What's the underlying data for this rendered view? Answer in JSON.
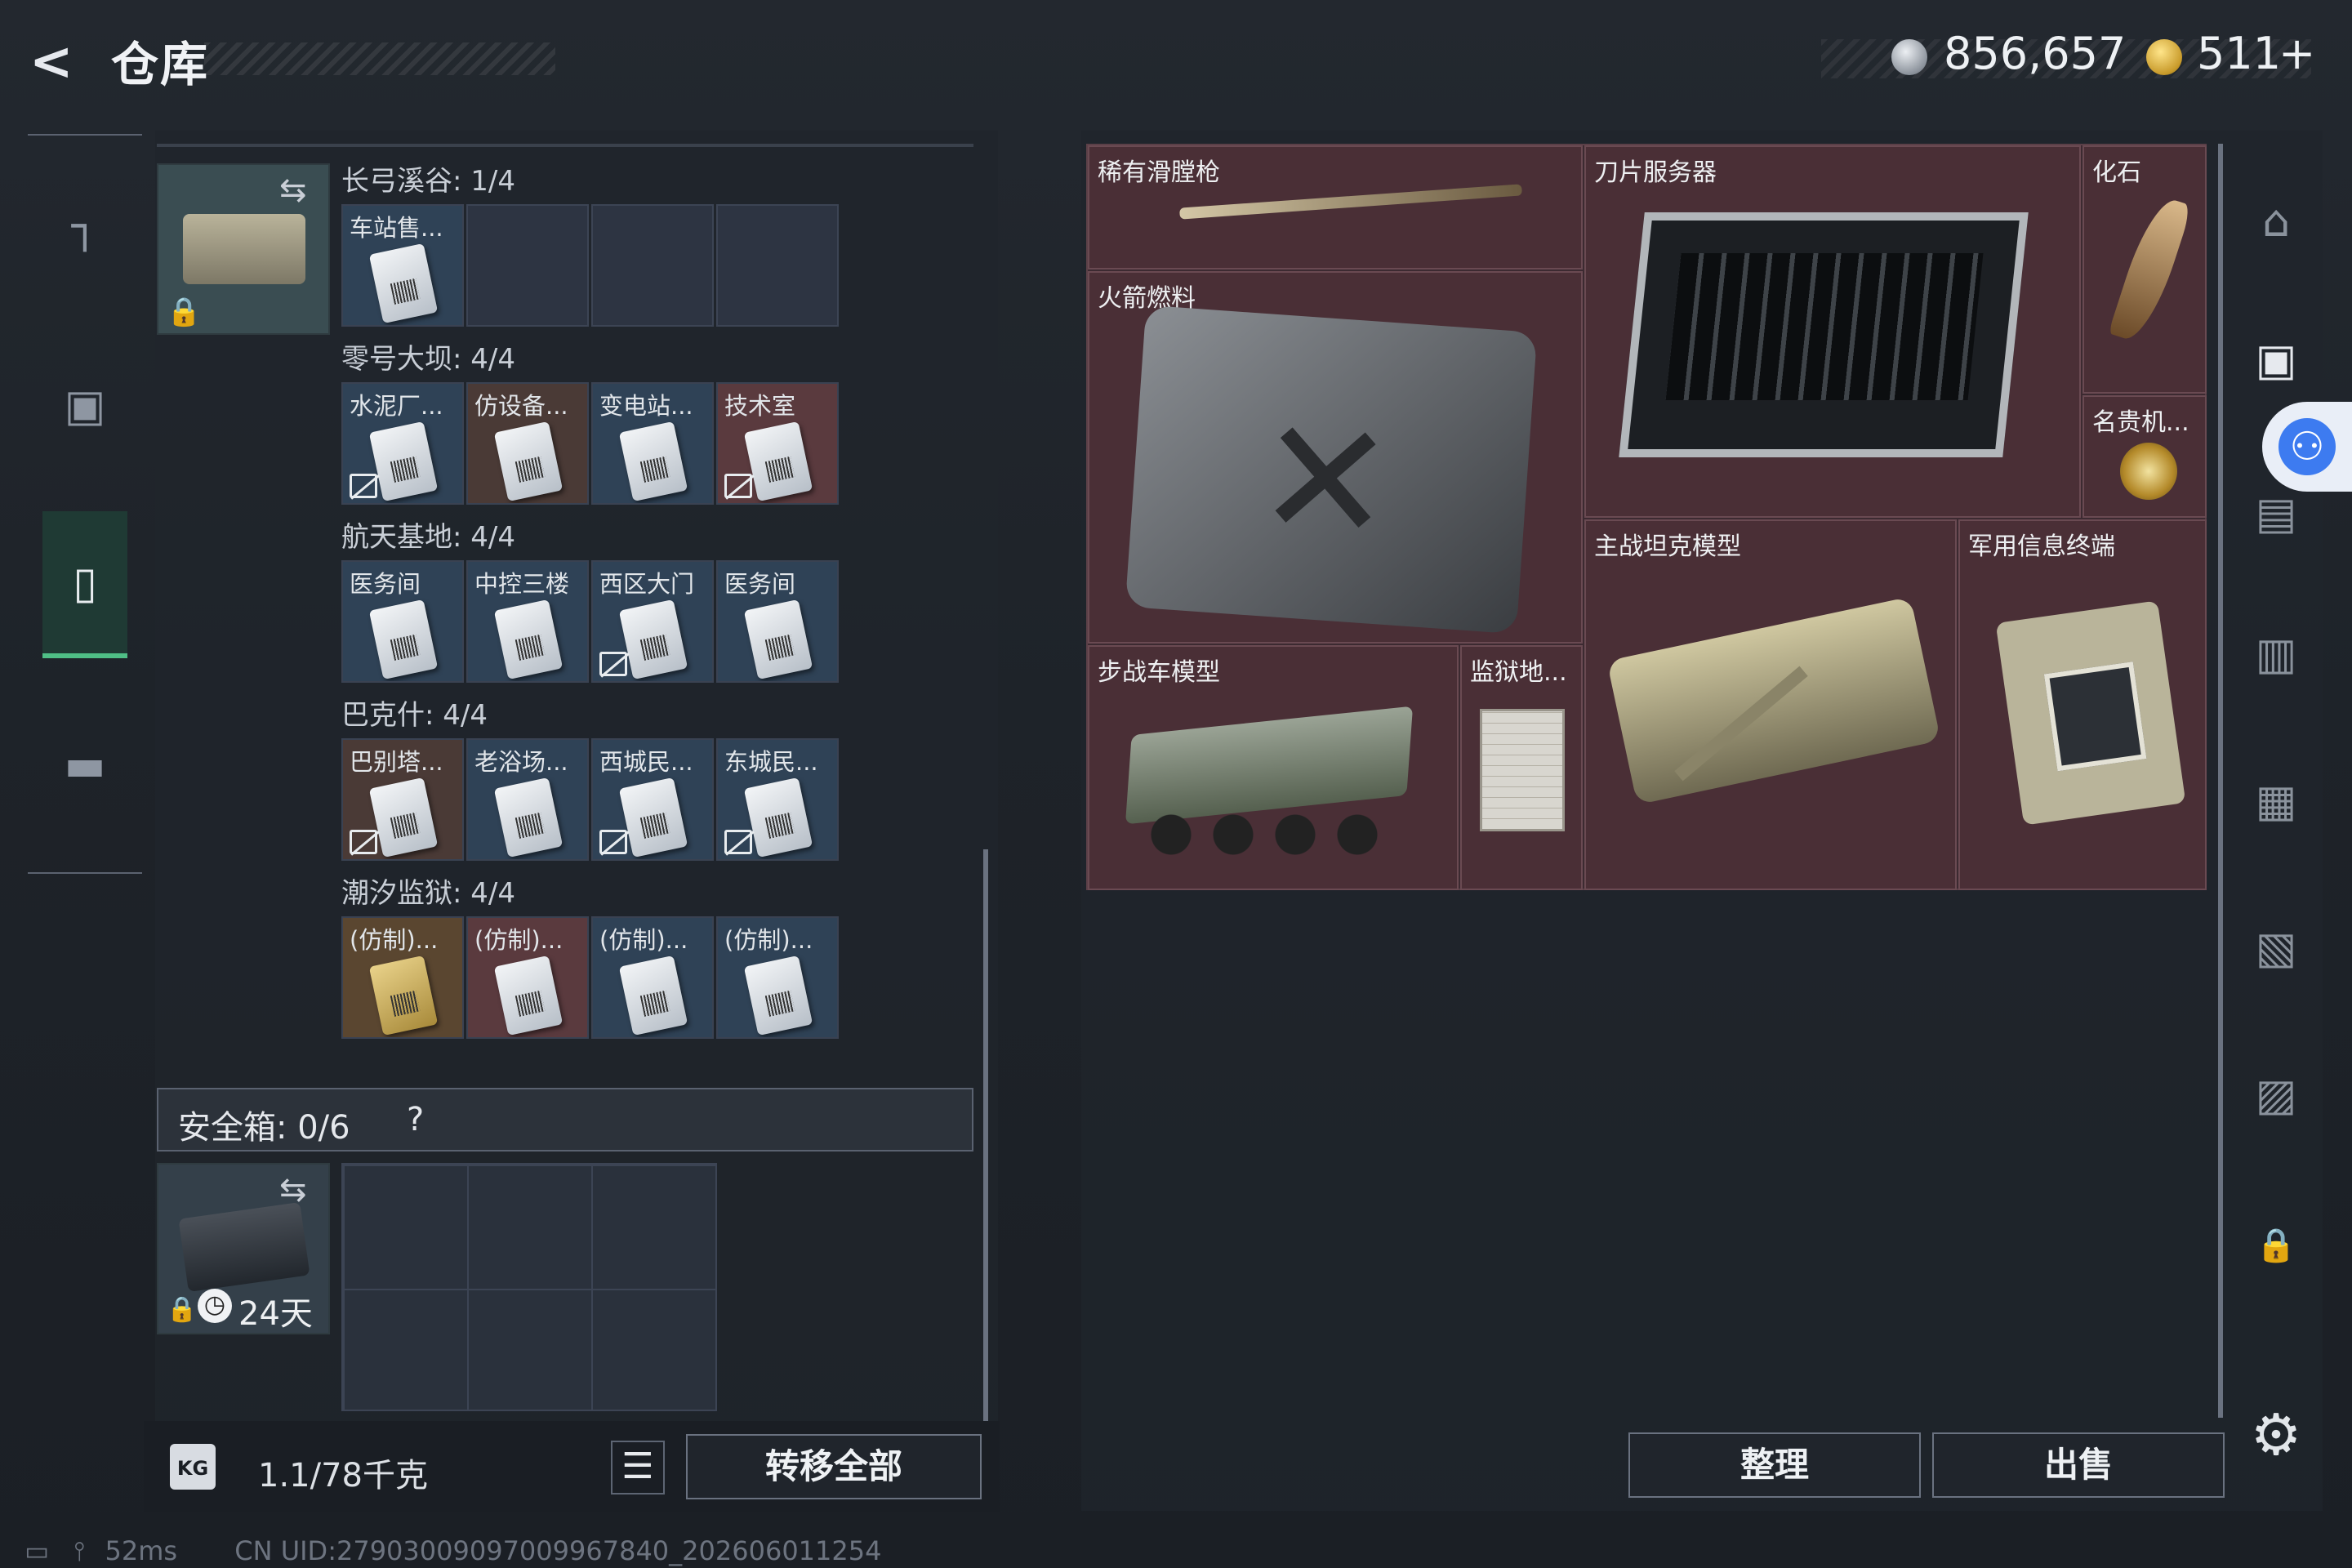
{
  "header": {
    "back_icon": "back-arrow-icon",
    "title": "仓库",
    "currency1": "856,657",
    "currency2": "511",
    "plus": "+"
  },
  "sidebar": {
    "items": [
      {
        "name": "weapons",
        "icon": "gun-icon"
      },
      {
        "name": "gear",
        "icon": "backpack-icon"
      },
      {
        "name": "keys",
        "icon": "clipboard-icon"
      },
      {
        "name": "misc",
        "icon": "briefcase-icon"
      }
    ]
  },
  "keycards": {
    "groups": [
      {
        "title": "长弓溪谷: 1/4",
        "slots": [
          "车站售...",
          "",
          "",
          ""
        ]
      },
      {
        "title": "零号大坝: 4/4",
        "slots": [
          "水泥厂...",
          "仿设备...",
          "变电站...",
          "技术室"
        ]
      },
      {
        "title": "航天基地: 4/4",
        "slots": [
          "医务间",
          "中控三楼",
          "西区大门",
          "医务间"
        ]
      },
      {
        "title": "巴克什: 4/4",
        "slots": [
          "巴别塔...",
          "老浴场...",
          "西城民...",
          "东城民..."
        ]
      },
      {
        "title": "潮汐监狱: 4/4",
        "slots": [
          "(仿制)...",
          "(仿制)...",
          "(仿制)...",
          "(仿制)..."
        ]
      }
    ]
  },
  "safe_box": {
    "label": "安全箱: 0/6",
    "help": "?",
    "timer": "24天"
  },
  "footer": {
    "weight": "1.1/78千克",
    "transfer": "转移全部"
  },
  "stash": {
    "items": [
      "稀有滑膛枪",
      "刀片服务器",
      "化石",
      "火箭燃料",
      "名贵机...",
      "主战坦克模型",
      "军用信息终端",
      "步战车模型",
      "监狱地..."
    ]
  },
  "actions": {
    "sort": "整理",
    "sell": "出售"
  },
  "status": {
    "ping": "52ms",
    "uid": "CN UID:27903009097009967840_202606011254"
  },
  "colors": {
    "accent_green": "#4fbf86",
    "rare_red": "#4a2f36",
    "access_blue": "#3d7bf0"
  }
}
